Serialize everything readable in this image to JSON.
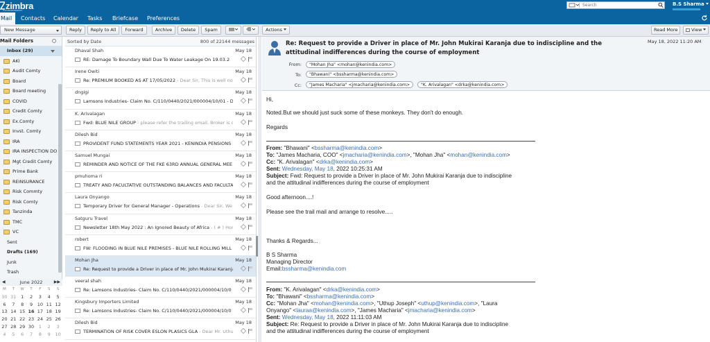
{
  "app": {
    "logo": "zimbra",
    "logo_sub": "A SYNACOR PRODUCT",
    "user_name": "B.S Sharma",
    "search_placeholder": "Search"
  },
  "app_tabs": [
    "Mail",
    "Contacts",
    "Calendar",
    "Tasks",
    "Briefcase",
    "Preferences"
  ],
  "toolbar": {
    "new_message": "New Message",
    "reply": "Reply",
    "reply_all": "Reply to All",
    "forward": "Forward",
    "archive": "Archive",
    "delete": "Delete",
    "spam": "Spam",
    "actions": "Actions",
    "read_more": "Read More",
    "view": "View"
  },
  "sidebar": {
    "header": "Mail Folders",
    "folders": [
      {
        "label": "Inbox (29)",
        "kind": "inbox"
      },
      {
        "label": "AKI"
      },
      {
        "label": "Audit Comty"
      },
      {
        "label": "Board"
      },
      {
        "label": "Board meeting"
      },
      {
        "label": "COVID"
      },
      {
        "label": "Credit Comty"
      },
      {
        "label": "Ex.Comty"
      },
      {
        "label": "Invst. Comty"
      },
      {
        "label": "IRA"
      },
      {
        "label": "IRA INSPECTION DO"
      },
      {
        "label": "Mgt Credit Comty"
      },
      {
        "label": "Prime Bank"
      },
      {
        "label": "REINSURANCE"
      },
      {
        "label": "Risk Commty"
      },
      {
        "label": "Risk Comty"
      },
      {
        "label": "Tanzinda"
      },
      {
        "label": "TMC"
      },
      {
        "label": "VC"
      },
      {
        "label": "Sent",
        "kind": "system"
      },
      {
        "label": "Drafts (169)",
        "kind": "bold"
      },
      {
        "label": "Junk",
        "kind": "system"
      },
      {
        "label": "Trash",
        "kind": "system"
      }
    ]
  },
  "calendar": {
    "month": "June 2022",
    "dow": [
      "M",
      "T",
      "W",
      "T",
      "F",
      "S",
      "S"
    ],
    "weeks": [
      [
        "30",
        "31",
        "1",
        "2",
        "3",
        "4",
        "5"
      ],
      [
        "6",
        "7",
        "8",
        "9",
        "10",
        "11",
        "12"
      ],
      [
        "13",
        "14",
        "15",
        "16",
        "17",
        "18",
        "19"
      ],
      [
        "20",
        "21",
        "22",
        "23",
        "24",
        "25",
        "26"
      ],
      [
        "27",
        "28",
        "29",
        "30",
        "1",
        "2",
        "3"
      ],
      [
        "4",
        "5",
        "6",
        "7",
        "8",
        "9",
        "10"
      ]
    ]
  },
  "list": {
    "sort_label": "Sorted by Date",
    "count_label": "800 of 22144 messages",
    "messages": [
      {
        "from": "Dhaval Shah",
        "date": "May 18",
        "subject": "RE: Damage To Boundary Wall Due To Water Leakage On 19.03.2",
        "fragment": ""
      },
      {
        "from": "Irene Owiti",
        "date": "May 18",
        "subject": "Re: PREMIUM BOOKED AS AT 17/05/2022",
        "fragment": " - Dear Sir, This is well no"
      },
      {
        "from": "dngigi",
        "date": "May 18",
        "subject": "Lamsons Industries- Claim No. C/110/0440/2021/000004/10/01 - D",
        "fragment": ""
      },
      {
        "from": "K. Arivalagan",
        "date": "May 18",
        "subject": "Fwd: BLUE NILE GROUP",
        "fragment": " - please refer the trailing email. Broker is c"
      },
      {
        "from": "Dilesh Bid",
        "date": "May 18",
        "subject": "PROVIDENT FUND STATEMENTS YEAR 2021 - KENINDIA PENSIONS",
        "fragment": ""
      },
      {
        "from": "Samuel Mungai",
        "date": "May 18",
        "subject": "REMINDER AND NOTICE OF THE FKE 63RD ANNUAL GENERAL MEE",
        "fragment": ""
      },
      {
        "from": "pmuhoma ri",
        "date": "May 18",
        "subject": "TREATY AND FACULTATIVE OUTSTANDING BALANCES AND FACULTA",
        "fragment": ""
      },
      {
        "from": "Laura Onyango",
        "date": "May 18",
        "subject": "Temporary Driver for General Manager - Operations",
        "fragment": " - Dear Sir, We hav"
      },
      {
        "from": "Satguru Travel",
        "date": "May 18",
        "subject": "Newsletter 18th May 2022 : An Ignored Beauty of Africa",
        "fragment": " - ( # ) Home ("
      },
      {
        "from": "robert",
        "date": "May 18",
        "subject": "FW: FLOODING IN BLUE NILE PREMISES - BLUE NILE ROLLING MILL",
        "fragment": ""
      },
      {
        "from": "Mohan Jha",
        "date": "May 18",
        "subject": "Re: Request to provide a Driver in place of Mr. John Mukirai Karanja du",
        "fragment": "",
        "selected": true
      },
      {
        "from": "veeral shah",
        "date": "May 18",
        "subject": "Re: Lamsons Industries- Claim No. C/110/0440/2021/000004/10/0",
        "fragment": " - No"
      },
      {
        "from": "Kingsbury Importers Limited",
        "date": "May 18",
        "subject": "Re: Lamsons Industries- Claim No. C/110/0440/2021/000004/10/0",
        "fragment": " - Hi"
      },
      {
        "from": "Dilesh Bid",
        "date": "May 18",
        "subject": "TERMINATION OF RISK COVER ESLON PLASICS GLA",
        "fragment": " - Dear Mr. Uthu"
      }
    ]
  },
  "reading": {
    "subject": "Re: Request to provide a Driver in place of Mr. John Mukirai Karanja due to indiscipline and the attitudinal indifferences during the course of employment",
    "date": "May 18, 2022 11:20 AM",
    "from_label": "From:",
    "to_label": "To:",
    "cc_label": "Cc:",
    "from": "\"Mohan Jha\" <mohan@kenindia.com>",
    "to": "\"Bhawani\" <bssharma@kenindia.com>",
    "cc": [
      "\"James Macharia\" <jmacharia@kenindia.com>",
      "\"K. Arivalagan\" <drka@kenindia.com>"
    ],
    "body": {
      "greeting": "Hi,",
      "line1": "Noted.But we should just suck some of these monkeys. They don't do enough.",
      "regards": "Regards",
      "q1": {
        "from_label": "From:",
        "from_name": " \"Bhawani\" <",
        "from_email": "bssharma@kenindia.com",
        "from_end": ">",
        "to_label": "To:",
        "to_a": " \"James Macharia, COO\" <",
        "to_a_email": "jmacharia@kenindia.com",
        "to_b": ">, \"Mohan Jha\" <",
        "to_b_email": "mohan@kenindia.com",
        "to_end": ">",
        "cc_label": "Cc:",
        "cc_a": " \"K. Arivalagan\" <",
        "cc_a_email": "drka@kenindia.com",
        "cc_end": ">",
        "sent_label": "Sent:",
        "sent_link": " Wednesday, May 18",
        "sent_rest": ", 2022 10:25:31 AM",
        "subject_label": "Subject:",
        "subject_1": " Fwd: Request to provide a Driver in place of Mr. John Mukirai Karanja due to  indiscipline",
        "subject_2": "and the attitudinal indifferences during the course of employment",
        "good": "Good afternoon....!",
        "please": "Please see the trail mail and arrange to resolve.....",
        "thanks": "Thanks & Regards...",
        "sig_name": "B S Sharma",
        "sig_title": "Managing Director",
        "sig_email_label": "Email:",
        "sig_email": "bssharma@kenindia.com"
      },
      "q2": {
        "from_label": "From:",
        "from_name": " \"K. Arivalagan\" <",
        "from_email": "drka@kenindia.com",
        "from_end": ">",
        "to_label": "To:",
        "to_a": " \"Bhawani\" <",
        "to_a_email": "bssharma@kenindia.com",
        "to_end": ">",
        "cc_label": "Cc:",
        "cc_a": " \"Mohan Jha\" <",
        "cc_a_email": "mohan@kenindia.com",
        "cc_b": ">, \"Uthup Joseph\" <",
        "cc_b_email": "uthup@kenindia.com",
        "cc_c": ">, \"Laura",
        "cc_line2_a": "Onyango\" <",
        "cc_line2_email": "lauraa@kenindia.com",
        "cc_line2_b": ">, \"James Macharia\" <",
        "cc_line2_email2": "jmacharia@kenindia.com",
        "cc_line2_end": ">",
        "sent_label": "Sent:",
        "sent_link": " Wednesday, May 18",
        "sent_rest": ", 2022 11:11:03 AM",
        "subject_label": "Subject:",
        "subject_1": " Re: Request to provide a Driver in place of Mr. John Mukirai Karanja due to  indiscipline",
        "subject_2": "and the attitudinal indifferences during the course of employment"
      }
    }
  },
  "colors": {
    "topbar": "#0b64a0",
    "selected_row": "#dbe7f3",
    "link": "#3a6fb7"
  }
}
